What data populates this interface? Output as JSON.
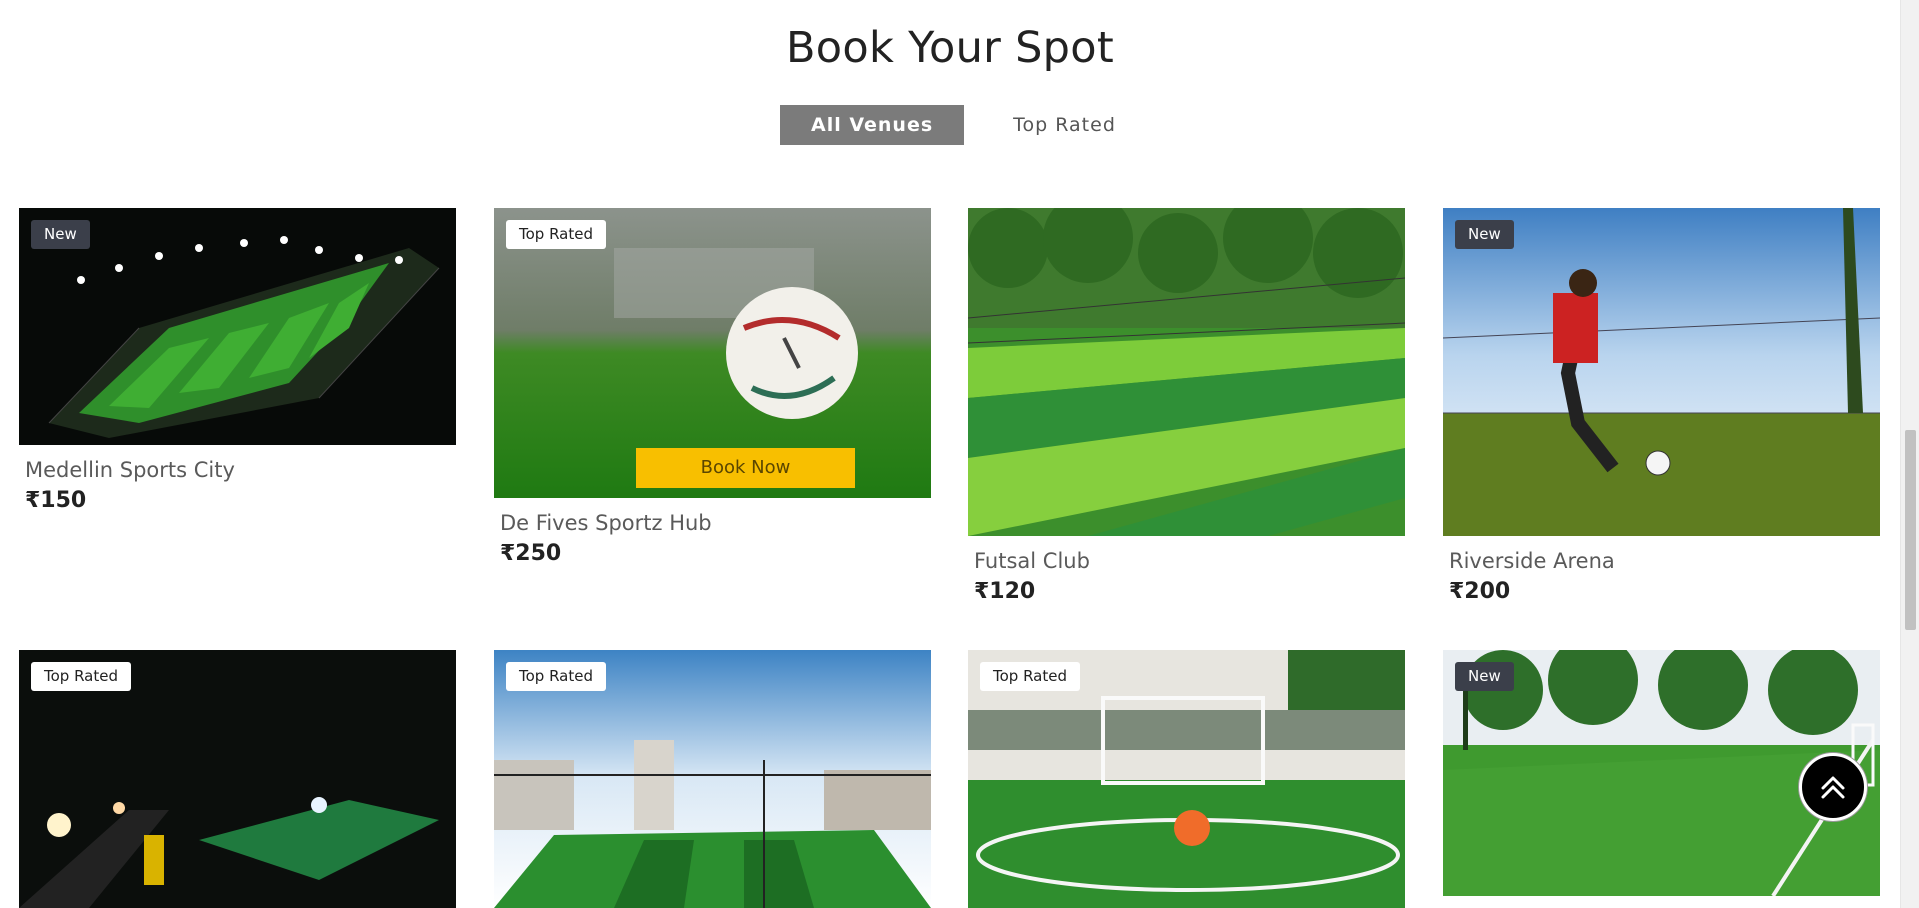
{
  "page": {
    "title": "Book Your Spot",
    "tabs": [
      {
        "label": "All Venues",
        "active": true
      },
      {
        "label": "Top Rated",
        "active": false
      }
    ]
  },
  "venues": [
    {
      "badge": "New",
      "name": "Medellin Sports City",
      "price": "₹150",
      "photo": "night-turf-aerial"
    },
    {
      "badge": "Top Rated",
      "name": "De Fives Sportz Hub",
      "price": "₹250",
      "photo": "football-on-grass",
      "action": "Book Now"
    },
    {
      "badge": "",
      "name": "Futsal Club",
      "price": "₹120",
      "photo": "striped-turf-palms"
    },
    {
      "badge": "New",
      "name": "Riverside Arena",
      "price": "₹200",
      "photo": "player-kicking-ball"
    },
    {
      "badge": "Top Rated",
      "photo": "roadside-turf-night"
    },
    {
      "badge": "Top Rated",
      "photo": "rooftop-turf-city"
    },
    {
      "badge": "Top Rated",
      "photo": "goalpost-orange-ball"
    },
    {
      "badge": "New",
      "photo": "open-pitch-palms"
    }
  ],
  "icons": {
    "scroll_top": "double-chevron-up-icon"
  },
  "colors": {
    "tab_active_bg": "#7b7b7b",
    "book_now_bg": "#f8bf00",
    "badge_dark": "#3b3f4a"
  }
}
